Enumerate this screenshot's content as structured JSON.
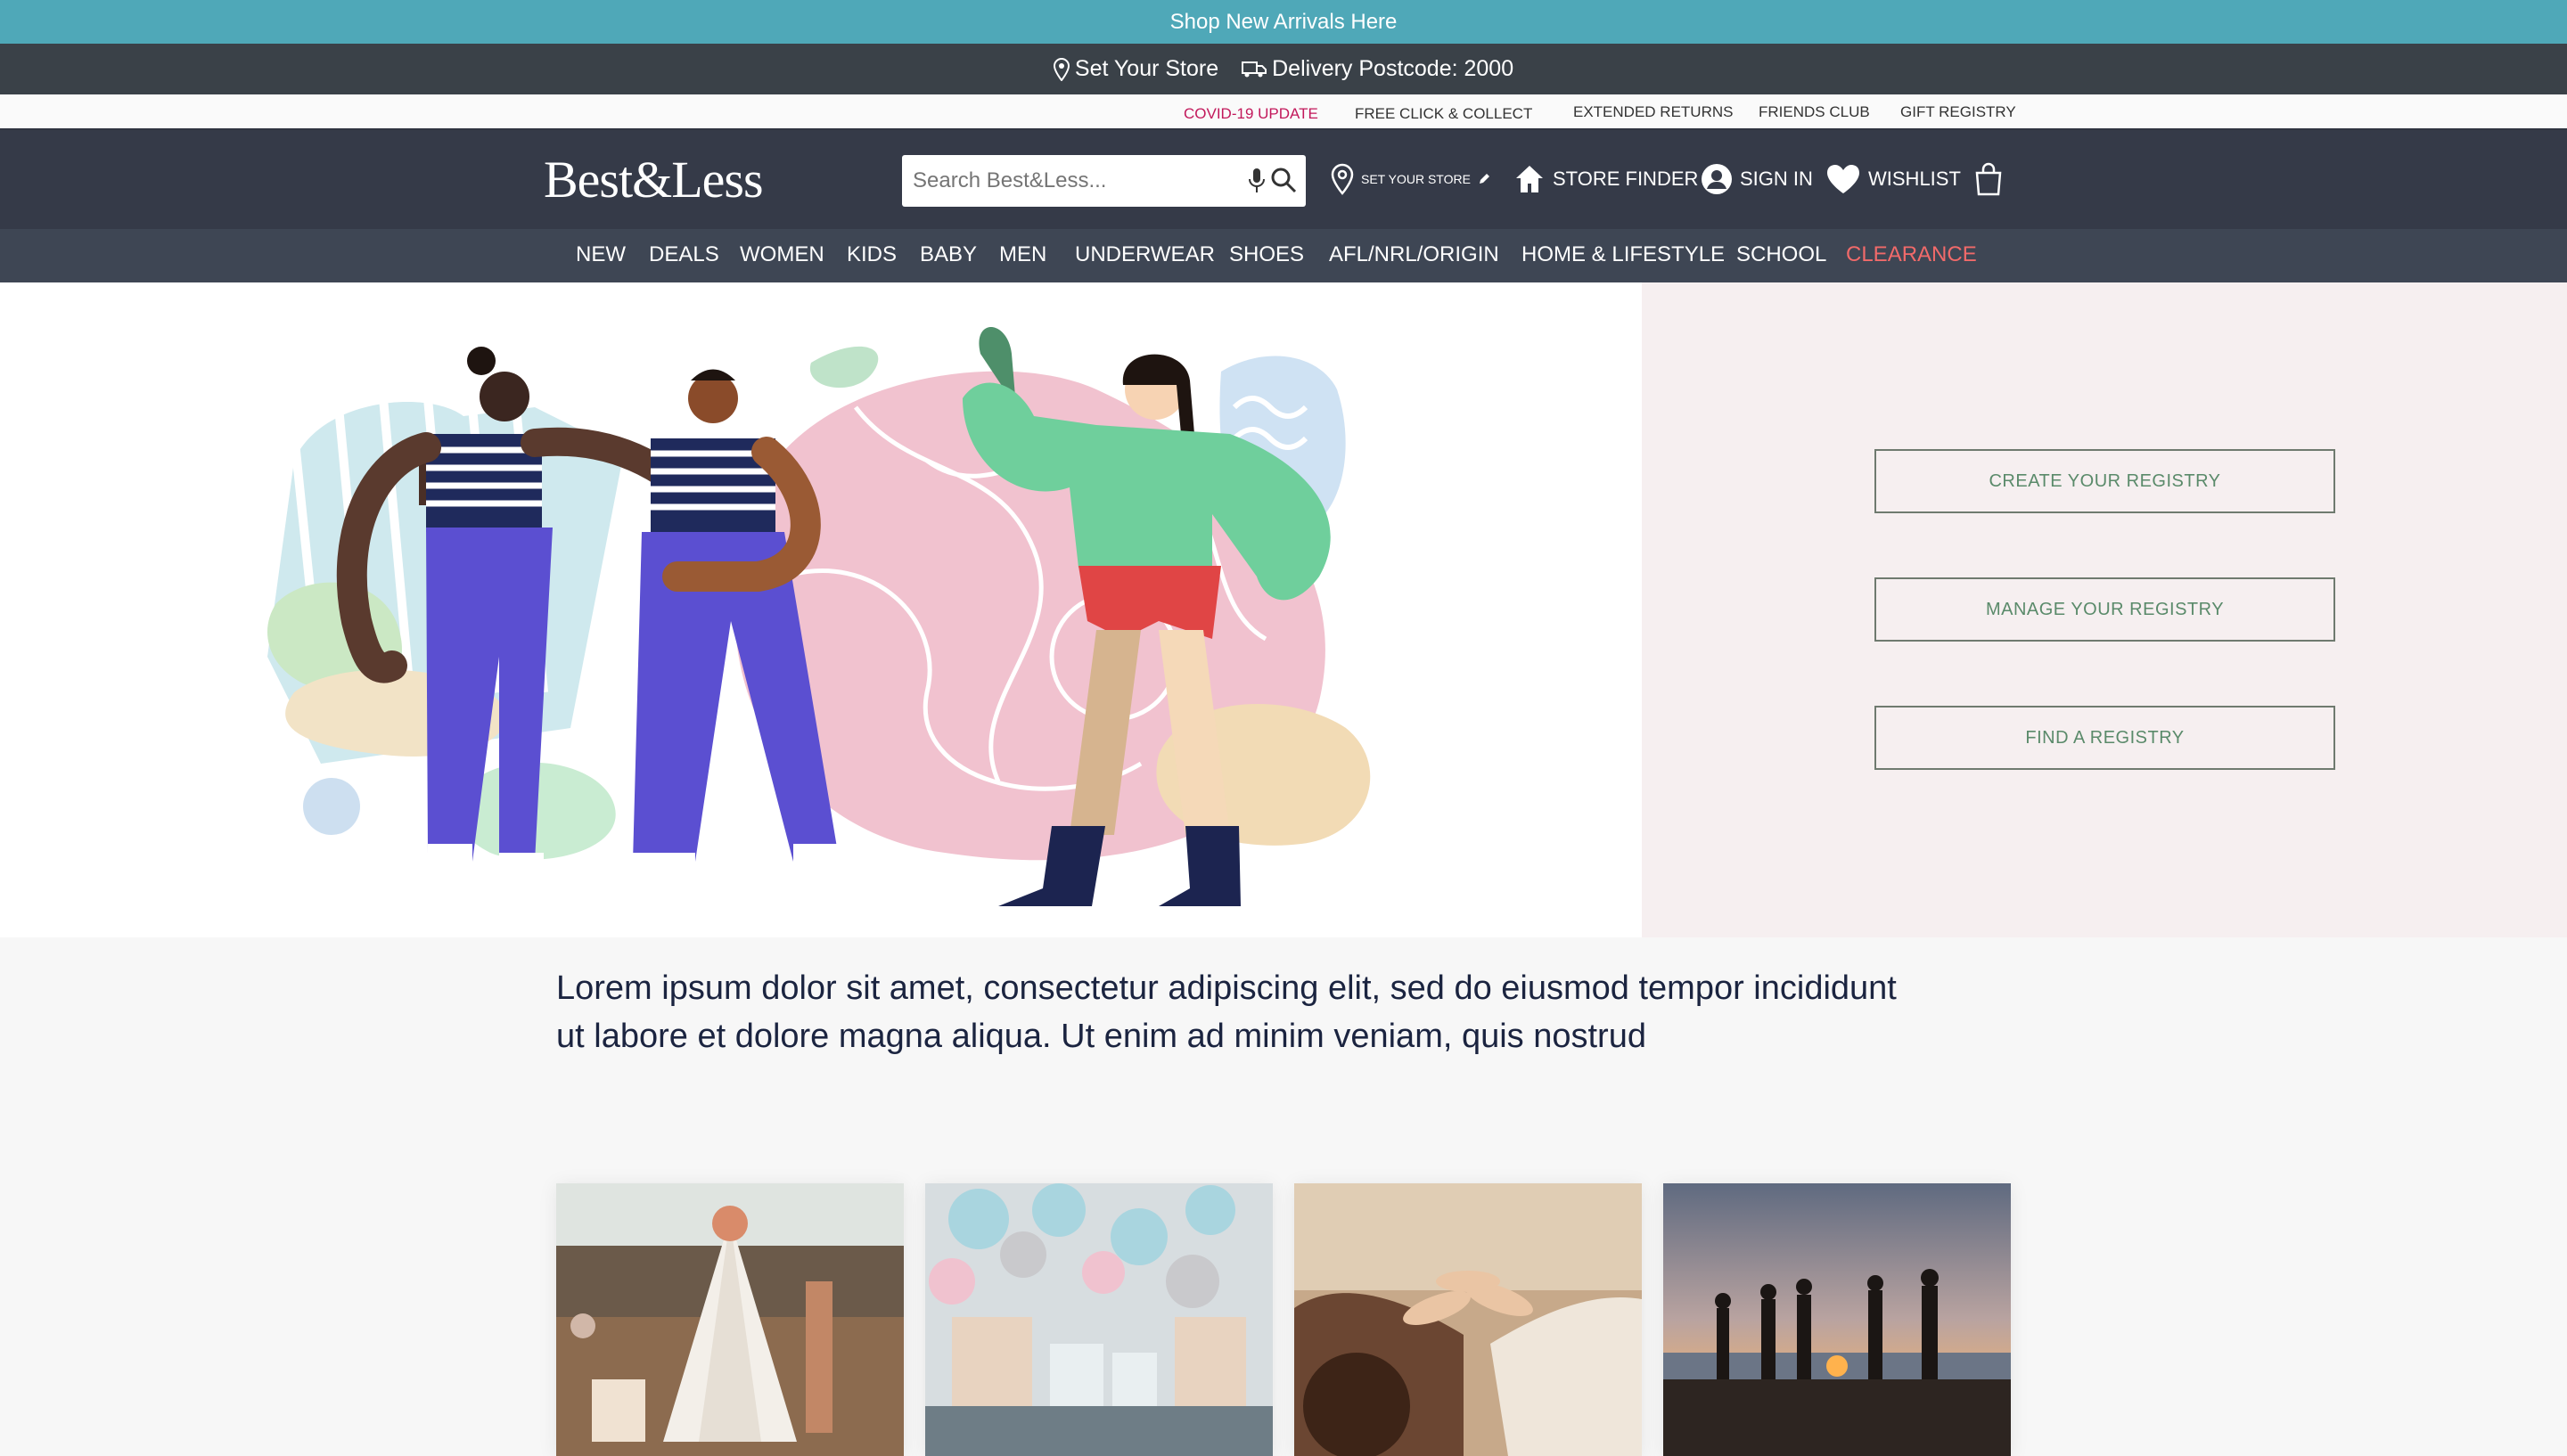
{
  "promo": {
    "text": "Shop New Arrivals Here"
  },
  "storebar": {
    "set_store": "Set Your Store",
    "delivery": "Delivery Postcode: 2000"
  },
  "utility": {
    "covid": "COVID-19 UPDATE",
    "click_collect": "FREE CLICK & COLLECT",
    "returns": "EXTENDED RETURNS",
    "friends": "FRIENDS CLUB",
    "gift": "GIFT REGISTRY"
  },
  "header": {
    "logo": "Best&Less",
    "search_placeholder": "Search Best&Less...",
    "set_store": "SET YOUR STORE",
    "store_finder": "STORE FINDER",
    "sign_in": "SIGN IN",
    "wishlist": "WISHLIST"
  },
  "nav": {
    "items": [
      "NEW",
      "DEALS",
      "WOMEN",
      "KIDS",
      "BABY",
      "MEN",
      "UNDERWEAR",
      "SHOES",
      "AFL/NRL/ORIGIN",
      "HOME & LIFESTYLE",
      "SCHOOL",
      "CLEARANCE"
    ]
  },
  "registry": {
    "create": "CREATE YOUR REGISTRY",
    "manage": "MANAGE YOUR REGISTRY",
    "find": "FIND A REGISTRY"
  },
  "intro": {
    "line1": "Lorem ipsum dolor sit amet, consectetur adipiscing elit, sed do eiusmod tempor incididunt",
    "line2": "ut labore et dolore magna aliqua. Ut enim ad minim veniam, quis nostrud"
  },
  "colors": {
    "promo_bg": "#4fa8b8",
    "header_bg": "#353a48",
    "nav_bg": "#3e4654",
    "clearance": "#f16a6a",
    "covid": "#c2185b",
    "registry_text": "#5a8a6a",
    "hero_right_bg": "#f6eff0"
  },
  "icons": [
    "location-pin-icon",
    "truck-icon",
    "search-icon",
    "microphone-icon",
    "pencil-icon",
    "home-icon",
    "user-icon",
    "heart-icon",
    "shopping-bag-icon"
  ]
}
